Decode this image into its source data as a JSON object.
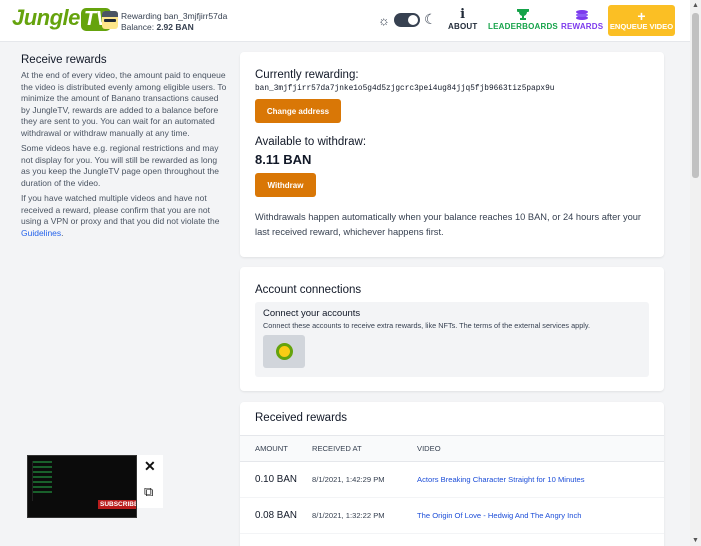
{
  "header": {
    "logo_text": "Jungle",
    "logo_tv": "TV",
    "rewarding_text": "Rewarding ban_3mjfjirr57da",
    "balance_label": "Balance:",
    "balance_value": "2.92 BAN",
    "about_label": "ABOUT",
    "leaderboards_label": "LEADERBOARDS",
    "rewards_label": "REWARDS",
    "enqueue_label": "ENQUEUE VIDEO"
  },
  "sidebar": {
    "title": "Receive rewards",
    "p1": "At the end of every video, the amount paid to enqueue the video is distributed evenly among eligible users. To minimize the amount of Banano transactions caused by JungleTV, rewards are added to a balance before they are sent to you. You can wait for an automated withdrawal or withdraw manually at any time.",
    "p2": "Some videos have e.g. regional restrictions and may not display for you. You will still be rewarded as long as you keep the JungleTV page open throughout the duration of the video.",
    "p3": "If you have watched multiple videos and have not received a reward, please confirm that you are not using a VPN or proxy and that you did not violate the",
    "guidelines_link": "Guidelines",
    "p3_end": "."
  },
  "rewarding": {
    "currently_label": "Currently rewarding:",
    "address": "ban_3mjfjirr57da7jnke1o5g4d5zjgcrc3pei4ug84jjq5fjb9663tiz5papx9u",
    "change_button": "Change address",
    "available_label": "Available to withdraw:",
    "available_amount": "8.11 BAN",
    "withdraw_button": "Withdraw",
    "withdraw_note": "Withdrawals happen automatically when your balance reaches 10 BAN, or 24 hours after your last received reward, whichever happens first."
  },
  "accounts": {
    "title": "Account connections",
    "connect_title": "Connect your accounts",
    "connect_sub": "Connect these accounts to receive extra rewards, like NFTs. The terms of the external services apply."
  },
  "received": {
    "title": "Received rewards",
    "columns": [
      "Amount",
      "Received at",
      "Video"
    ],
    "rows": [
      {
        "amount": "0.10 BAN",
        "received_at": "8/1/2021, 1:42:29 PM",
        "video": "Actors Breaking Character Straight for 10 Minutes"
      },
      {
        "amount": "0.08 BAN",
        "received_at": "8/1/2021, 1:32:22 PM",
        "video": "The Origin Of Love - Hedwig And The Angry Inch"
      }
    ]
  },
  "player": {
    "subscribe_text": "SUBSCRIBE"
  },
  "colors": {
    "brand_green": "#65a30d",
    "accent_orange": "#d97706",
    "enqueue_yellow": "#fbbf24",
    "rewards_purple": "#7c3aed",
    "leaderboards_green": "#16a34a"
  }
}
